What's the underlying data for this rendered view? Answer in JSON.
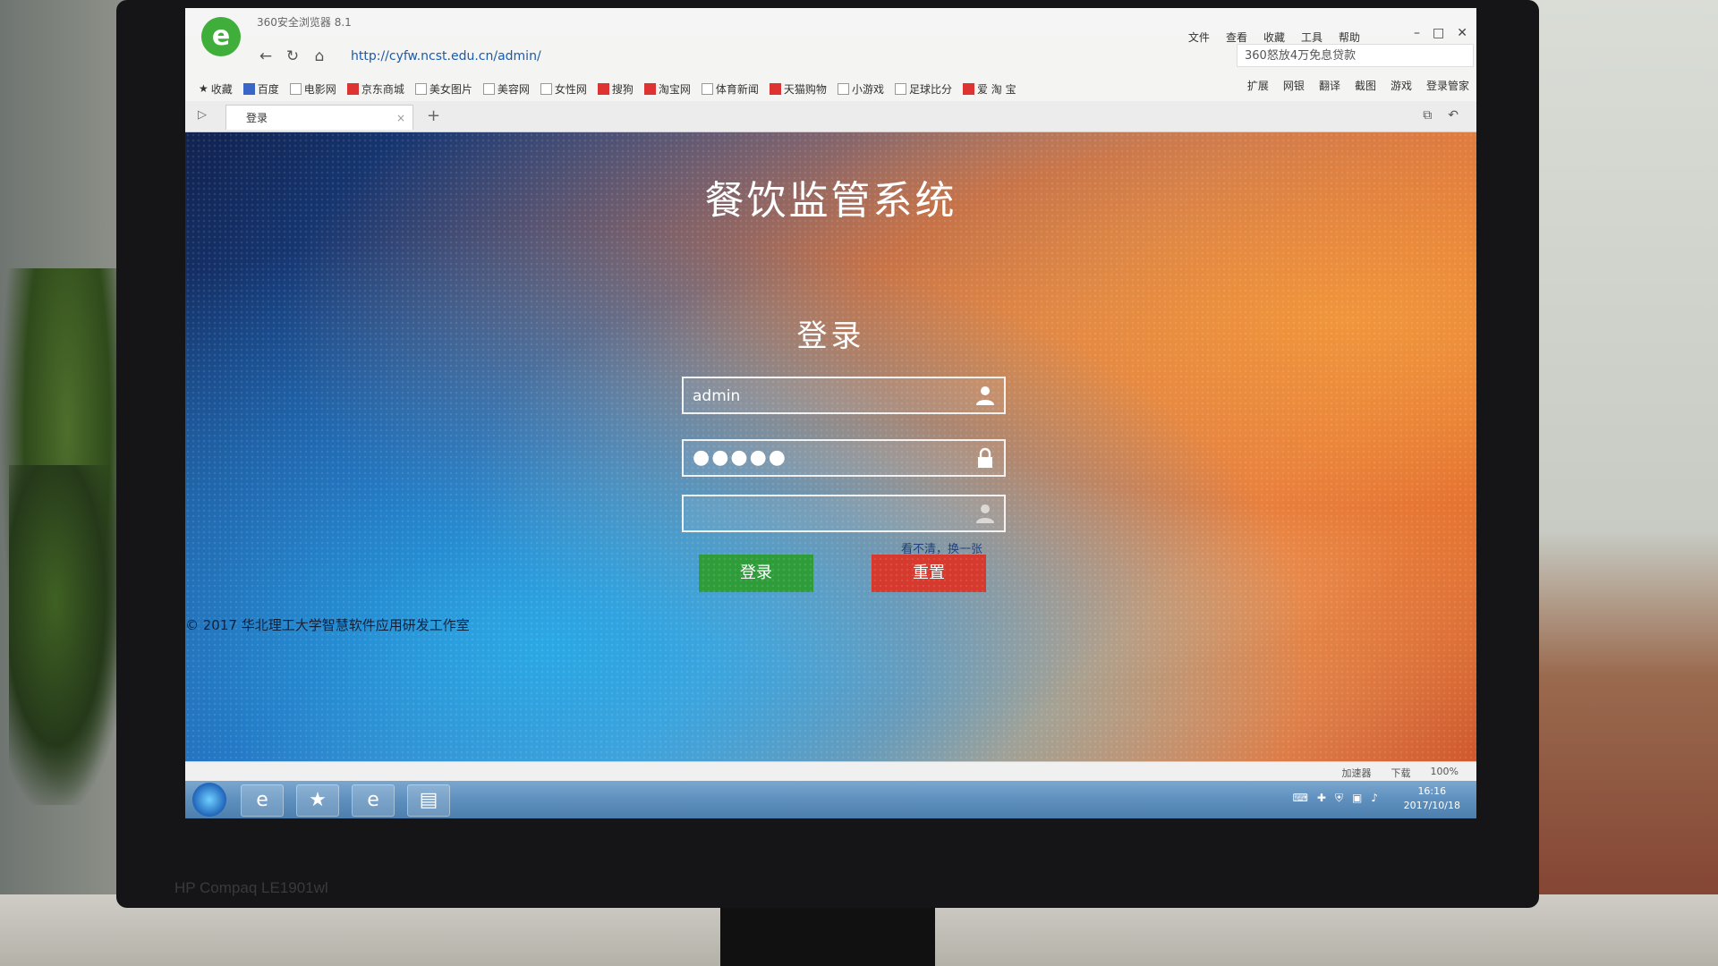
{
  "browser": {
    "app_title": "360安全浏览器 8.1",
    "menu": [
      "文件",
      "查看",
      "收藏",
      "工具",
      "帮助"
    ],
    "url": "http://cyfw.ncst.edu.cn/admin/",
    "search_placeholder": "360怒放4万免息贷款",
    "bookmarks": [
      "收藏",
      "百度",
      "电影网",
      "京东商城",
      "美女图片",
      "美容网",
      "女性网",
      "搜狗",
      "淘宝网",
      "体育新闻",
      "天猫购物",
      "小游戏",
      "足球比分",
      "爱 淘 宝"
    ],
    "tools": [
      "扩展",
      "网银",
      "翻译",
      "截图",
      "游戏",
      "登录管家"
    ],
    "tab_label": "登录",
    "status_items": [
      "加速器",
      "下载",
      "100%"
    ]
  },
  "page": {
    "system_title": "餐饮监管系统",
    "login_title": "登录",
    "username_value": "admin",
    "password_mask": "●●●●●",
    "captcha_refresh": "看不清，换一张",
    "login_button": "登录",
    "reset_button": "重置",
    "footer": "© 2017 华北理工大学智慧软件应用研发工作室"
  },
  "taskbar": {
    "time": "16:16",
    "date": "2017/10/18"
  },
  "monitor": {
    "brand": "HP Compaq LE1901wl"
  }
}
